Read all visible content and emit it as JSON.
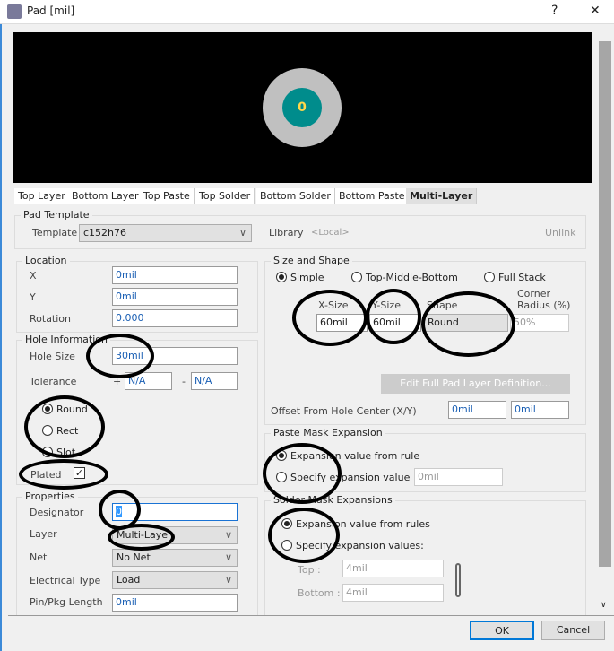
{
  "window": {
    "title": "Pad [mil]",
    "help": "?",
    "close": "✕"
  },
  "preview": {
    "designator": "0",
    "pad_color": "#c0c0c0",
    "hole_color": "#008c8c"
  },
  "tabs": [
    "Top Layer",
    "Bottom Layer",
    "Top Paste",
    "Top Solder",
    "Bottom Solder",
    "Bottom Paste",
    "Multi-Layer"
  ],
  "pad_template": {
    "title": "Pad Template",
    "template_label": "Template",
    "template_value": "c152h76",
    "library_label": "Library",
    "library_value": "<Local>",
    "unlink": "Unlink"
  },
  "location": {
    "title": "Location",
    "x_label": "X",
    "x": "0mil",
    "y_label": "Y",
    "y": "0mil",
    "rotation_label": "Rotation",
    "rotation": "0.000"
  },
  "hole": {
    "title": "Hole Information",
    "size_label": "Hole Size",
    "size": "30mil",
    "tolerance_label": "Tolerance",
    "plus": "+",
    "minus": "-",
    "tol_plus": "N/A",
    "tol_minus": "N/A",
    "shapes": [
      "Round",
      "Rect",
      "Slot"
    ],
    "plated_label": "Plated"
  },
  "properties": {
    "title": "Properties",
    "designator_label": "Designator",
    "designator": "0",
    "layer_label": "Layer",
    "layer": "Multi-Layer",
    "net_label": "Net",
    "net": "No Net",
    "etype_label": "Electrical Type",
    "etype": "Load",
    "pinlen_label": "Pin/Pkg Length",
    "pinlen": "0mil"
  },
  "size_shape": {
    "title": "Size and Shape",
    "modes": [
      "Simple",
      "Top-Middle-Bottom",
      "Full Stack"
    ],
    "xsize_label": "X-Size",
    "xsize": "60mil",
    "ysize_label": "Y-Size",
    "ysize": "60mil",
    "shape_label": "Shape",
    "shape": "Round",
    "corner_label1": "Corner",
    "corner_label2": "Radius (%)",
    "corner": "50%",
    "edit_button": "Edit Full Pad Layer Definition...",
    "offset_label": "Offset From Hole Center (X/Y)",
    "offset_x": "0mil",
    "offset_y": "0mil"
  },
  "paste_mask": {
    "title": "Paste Mask Expansion",
    "opt1": "Expansion value from rule",
    "opt2": "Specify expansion value",
    "value": "0mil"
  },
  "solder_mask": {
    "title": "Solder Mask Expansions",
    "opt1": "Expansion value from rules",
    "opt2": "Specify expansion values:",
    "top_label": "Top :",
    "top": "4mil",
    "bottom_label": "Bottom :",
    "bottom": "4mil"
  },
  "buttons": {
    "ok": "OK",
    "cancel": "Cancel"
  }
}
